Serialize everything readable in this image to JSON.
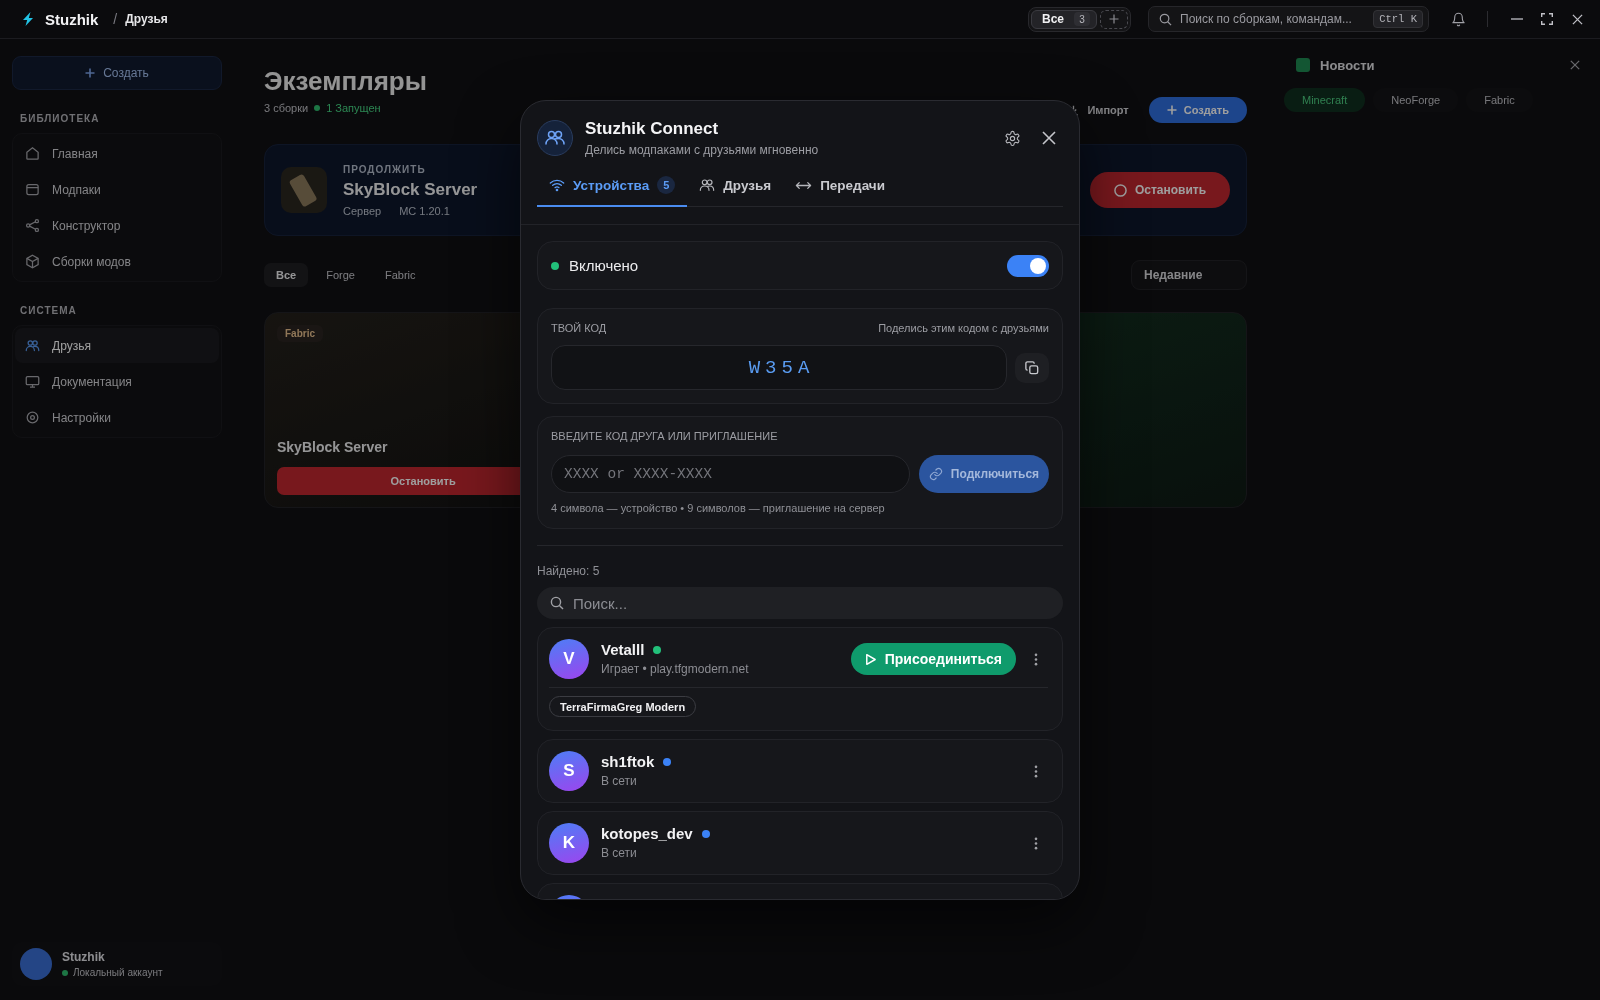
{
  "title_bar": {
    "app_name": "Stuzhik",
    "breadcrumb_separator": "/",
    "breadcrumb": "Друзья",
    "scope_filter": {
      "label": "Все",
      "count": "3"
    },
    "search": {
      "placeholder": "Поиск по сборкам, командам...",
      "shortcut": "Ctrl K"
    }
  },
  "sidebar": {
    "create_button": "Создать",
    "sections": [
      {
        "title": "БИБЛИОТЕКА",
        "items": [
          {
            "label": "Главная",
            "selected": false
          },
          {
            "label": "Модпаки",
            "selected": false
          },
          {
            "label": "Конструктор",
            "selected": false
          },
          {
            "label": "Сборки модов",
            "selected": false
          }
        ]
      },
      {
        "title": "СИСТЕМА",
        "items": [
          {
            "label": "Друзья",
            "selected": true
          },
          {
            "label": "Документация",
            "selected": false
          },
          {
            "label": "Настройки",
            "selected": false
          }
        ]
      }
    ],
    "account": {
      "name": "Stuzhik",
      "status": "Локальный аккаунт"
    }
  },
  "instances": {
    "title": "Экземпляры",
    "count": "3 сборки",
    "running": "1 Запущен",
    "import_button": "Импорт",
    "create_button": "Создать",
    "continue": {
      "eyebrow": "ПРОДОЛЖИТЬ",
      "name": "SkyBlock Server",
      "meta": [
        "Сервер",
        "MC 1.20.1"
      ],
      "stop_button": "Остановить"
    },
    "filters": [
      {
        "label": "Все",
        "selected": true
      },
      {
        "label": "Forge",
        "selected": false
      },
      {
        "label": "Fabric",
        "selected": false
      }
    ],
    "sort": "Недавние",
    "cards": [
      {
        "loader": "Fabric",
        "name": "SkyBlock Server",
        "stop_button": "Остановить"
      }
    ]
  },
  "news": {
    "title": "Новости",
    "tabs": [
      {
        "label": "Minecraft",
        "selected": true
      },
      {
        "label": "NeoForge",
        "selected": false
      },
      {
        "label": "Fabric",
        "selected": false
      }
    ]
  },
  "connect_dialog": {
    "title": "Stuzhik Connect",
    "subtitle": "Делись модпаками с друзьями мгновенно",
    "tabs": [
      {
        "label": "Устройства",
        "count": "5",
        "selected": true
      },
      {
        "label": "Друзья",
        "selected": false
      },
      {
        "label": "Передачи",
        "selected": false
      }
    ],
    "enabled": {
      "label": "Включено",
      "on": true
    },
    "your_code": {
      "label": "ТВОЙ КОД",
      "hint": "Поделись этим кодом с друзьями",
      "code": "W35A"
    },
    "join": {
      "label": "ВВЕДИТЕ КОД ДРУГА ИЛИ ПРИГЛАШЕНИЕ",
      "placeholder": "XXXX or XXXX-XXXX",
      "button": "Подключиться",
      "disabled": true,
      "hint": "4 символа — устройство • 9 символов — приглашение на сервер"
    },
    "found": "Найдено: 5",
    "search": {
      "placeholder": "Поиск..."
    },
    "devices": [
      {
        "initial": "V",
        "name": "Vetalll",
        "color": "#22c07a",
        "status": "Играет • play.tfgmodern.net",
        "join_button": "Присоединиться",
        "modpack": "TerraFirmaGreg Modern"
      },
      {
        "initial": "S",
        "name": "sh1ftok",
        "color": "#3b82f6",
        "status": "В сети"
      },
      {
        "initial": "K",
        "name": "kotopes_dev",
        "color": "#3b82f6",
        "status": "В сети"
      }
    ],
    "list_continues": true
  }
}
